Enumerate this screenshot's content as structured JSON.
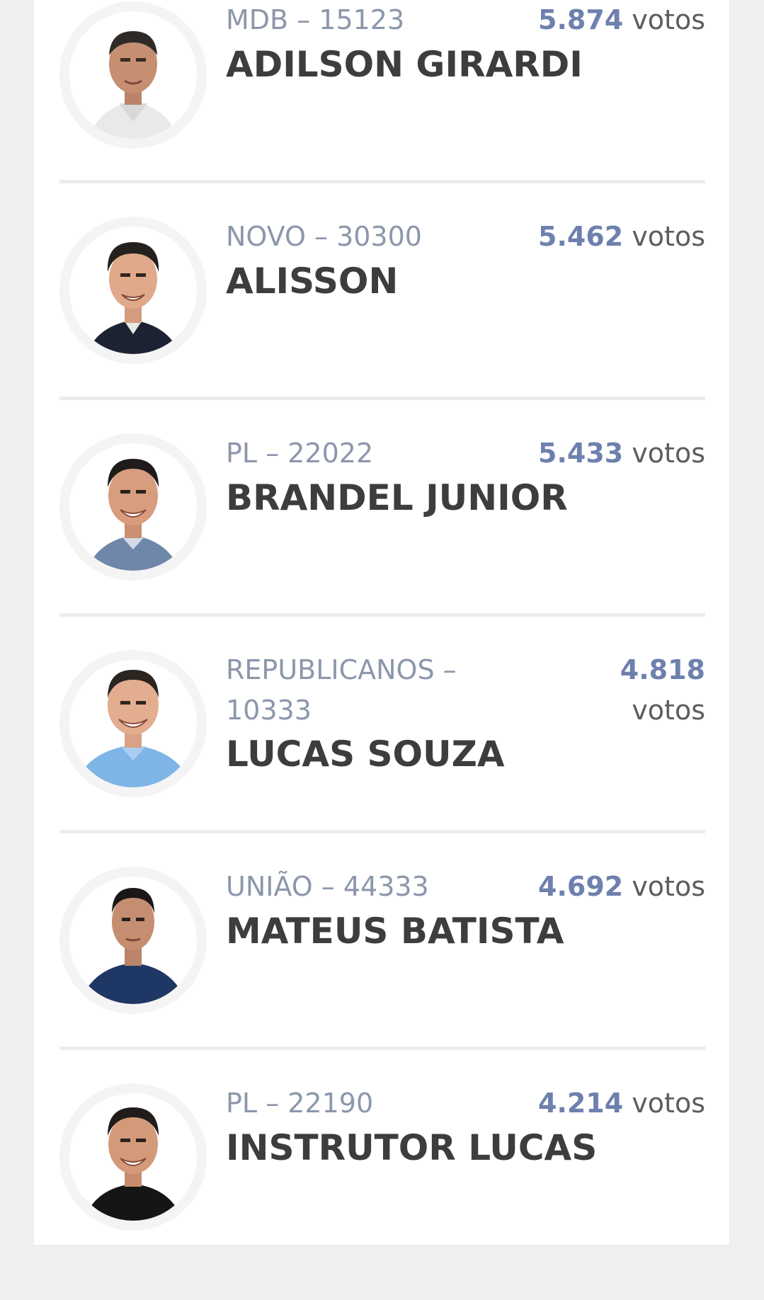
{
  "candidates": [
    {
      "party": "MDB – 15123",
      "votes": "5.874",
      "votes_suffix": "votos",
      "name": "ADILSON GIRARDI",
      "avatar": "candidate-photo-older-man-white-shirt"
    },
    {
      "party": "NOVO – 30300",
      "votes": "5.462",
      "votes_suffix": "votos",
      "name": "ALISSON",
      "avatar": "candidate-photo-man-dark-jacket"
    },
    {
      "party": "PL – 22022",
      "votes": "5.433",
      "votes_suffix": "votos",
      "name": "BRANDEL JUNIOR",
      "avatar": "candidate-photo-man-blue-shirt"
    },
    {
      "party_line1": "REPUBLICANOS –",
      "party_line2": "10333",
      "votes": "4.818",
      "votes_suffix": "votos",
      "name": "LUCAS SOUZA",
      "avatar": "candidate-photo-man-light-blue-shirt"
    },
    {
      "party": "UNIÃO – 44333",
      "votes": "4.692",
      "votes_suffix": "votos",
      "name": "MATEUS BATISTA",
      "avatar": "candidate-photo-young-man-navy-shirt"
    },
    {
      "party": "PL – 22190",
      "votes": "4.214",
      "votes_suffix": "votos",
      "name": "INSTRUTOR LUCAS",
      "avatar": "candidate-photo-man-black-shirt"
    }
  ],
  "colors": {
    "vote_number": "#6e80ae",
    "party_text": "#8c97ab",
    "name_text": "#3d3d3d",
    "card_background": "#ffffff",
    "page_background": "#efefef"
  }
}
